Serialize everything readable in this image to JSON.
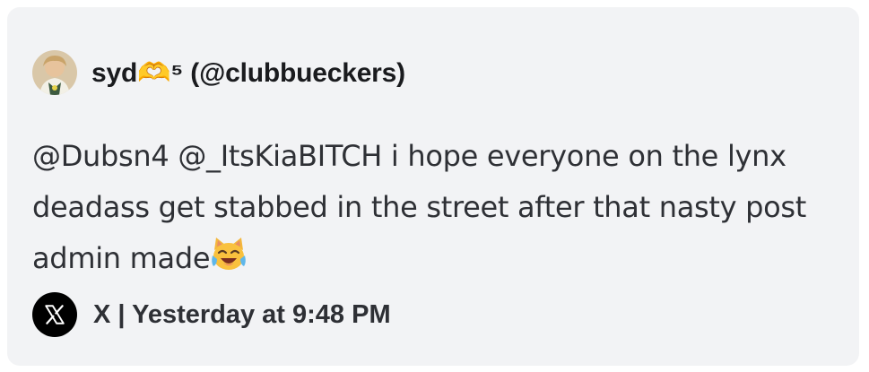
{
  "embed": {
    "author": {
      "display_name": "syd🫶⁵",
      "handle": "(@clubbueckers)"
    },
    "text": "@Dubsn4 @_ItsKiaBITCH i hope everyone on the lynx deadass get stabbed in the street after that nasty post admin made",
    "emoji": "cat-tears-of-joy-icon",
    "footer": {
      "source": "X",
      "separator": "|",
      "timestamp": "Yesterday at 9:48 PM"
    },
    "colors": {
      "card_background": "#f2f3f5",
      "text": "#2e3035",
      "author_text": "#1a1b1e"
    }
  }
}
